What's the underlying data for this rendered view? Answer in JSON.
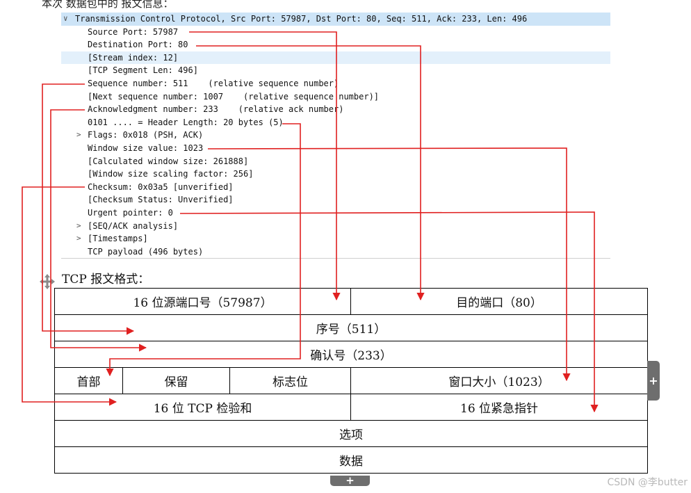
{
  "top_text": "本次    数据包中的     报文信息：",
  "tree": {
    "header": "Transmission Control Protocol, Src Port: 57987, Dst Port: 80, Seq: 511, Ack: 233, Len: 496",
    "items": [
      "Source Port: 57987",
      "Destination Port: 80",
      "[Stream index: 12]",
      "[TCP Segment Len: 496]",
      "Sequence number: 511    (relative sequence number)",
      "[Next sequence number: 1007    (relative sequence number)]",
      "Acknowledgment number: 233    (relative ack number)",
      "0101 .... = Header Length: 20 bytes (5)",
      "Flags: 0x018 (PSH, ACK)",
      "Window size value: 1023",
      "[Calculated window size: 261888]",
      "[Window size scaling factor: 256]",
      "Checksum: 0x03a5 [unverified]",
      "[Checksum Status: Unverified]",
      "Urgent pointer: 0",
      "[SEQ/ACK analysis]",
      "[Timestamps]",
      "TCP payload (496 bytes)"
    ]
  },
  "format_caption": "TCP 报文格式：",
  "format_table": {
    "source_port": "16 位源端口号（57987）",
    "dest_port": "目的端口（80）",
    "seq": "序号（511）",
    "ack": "确认号（233）",
    "header_len": "首部",
    "reserved": "保留",
    "flags": "标志位",
    "window": "窗口大小（1023）",
    "checksum": "16 位 TCP 检验和",
    "urgent": "16 位紧急指针",
    "options": "选项",
    "data": "数据"
  },
  "colors": {
    "arrow": "#e02020",
    "header_highlight": "#cde4f7",
    "row_highlight": "#e3f0fb"
  },
  "watermark": "CSDN @李butter"
}
